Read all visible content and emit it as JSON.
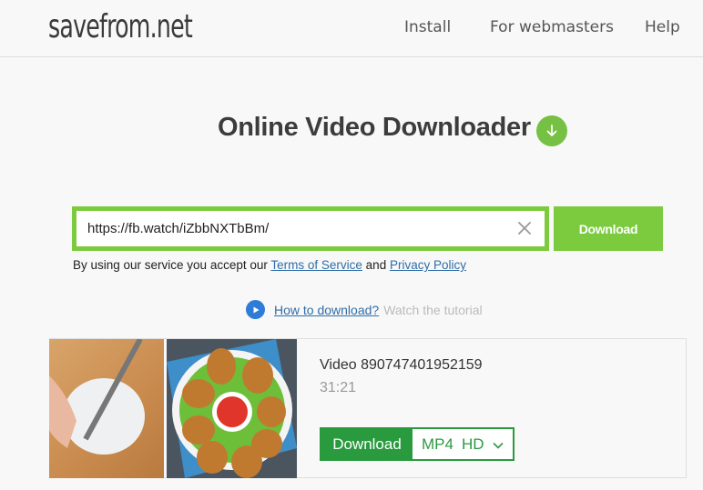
{
  "header": {
    "logo": "savefrom.net",
    "nav": [
      {
        "label": "Install"
      },
      {
        "label": "For webmasters"
      },
      {
        "label": "Help"
      }
    ]
  },
  "main": {
    "title": "Online Video Downloader",
    "title_icon": "download-arrow-icon",
    "url_input": {
      "value": "https://fb.watch/iZbbNXTbBm/",
      "clear_icon": "close-icon"
    },
    "download_button": "Download",
    "terms": {
      "prefix": "By using our service you accept our",
      "terms_link": "Terms of Service",
      "and": "and",
      "privacy_link": "Privacy Policy"
    },
    "howto": {
      "icon": "play-icon",
      "link": "How to download?",
      "note": "Watch the tutorial"
    }
  },
  "result": {
    "title": "Video 890747401952159",
    "duration": "31:21",
    "download_label": "Download",
    "format": "MP4",
    "quality": "HD",
    "colors": {
      "accent": "#7ccb3f",
      "dark_green": "#2a9a3f",
      "link": "#2f6ea8"
    }
  }
}
